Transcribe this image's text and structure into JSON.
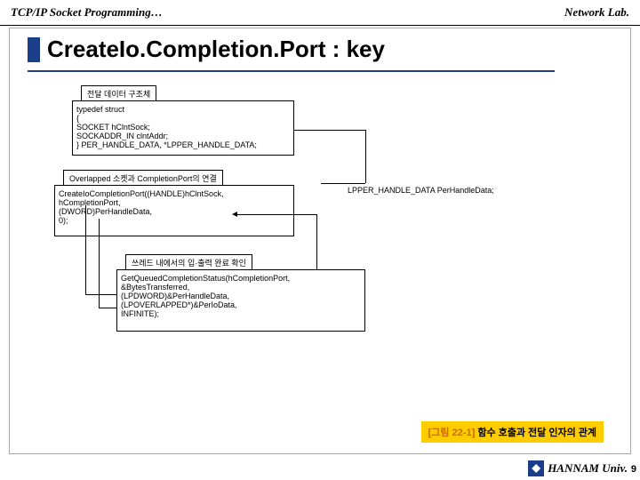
{
  "header": {
    "left": "TCP/IP Socket Programming…",
    "right": "Network Lab."
  },
  "title": "CreateIo.Completion.Port : key",
  "boxes": {
    "header1": "전달 데이터 구조체",
    "body1_line1": "typedef struct",
    "body1_line2": "{",
    "body1_line3": "    SOCKET hClntSock;",
    "body1_line4": "    SOCKADDR_IN clntAddr;",
    "body1_line5": "} PER_HANDLE_DATA, *LPPER_HANDLE_DATA;",
    "label1": "LPPER_HANDLE_DATA PerHandleData;",
    "header2": "Overlapped 소켓과 CompletionPort의 연결",
    "body2_line1": "CreateIoCompletionPort((HANDLE)hClntSock,",
    "body2_line2": "                       hCompletionPort,",
    "body2_line3": "                       (DWORD)PerHandleData,",
    "body2_line4": "                       0);",
    "header3": "쓰레드 내에서의 입·출력 완료 확인",
    "body3_line1": "GetQueuedCompletionStatus(hCompletionPort,",
    "body3_line2": "                          &BytesTransferred,",
    "body3_line3": "                          (LPDWORD)&PerHandleData,",
    "body3_line4": "                          (LPOVERLAPPED*)&PerIoData,",
    "body3_line5": "                          INFINITE);"
  },
  "caption": {
    "prefix": "[그림 22-1]",
    "text": " 함수 호출과 전달 인자의 관계"
  },
  "footer": {
    "text": "HANNAM Univ.",
    "page": "9"
  }
}
